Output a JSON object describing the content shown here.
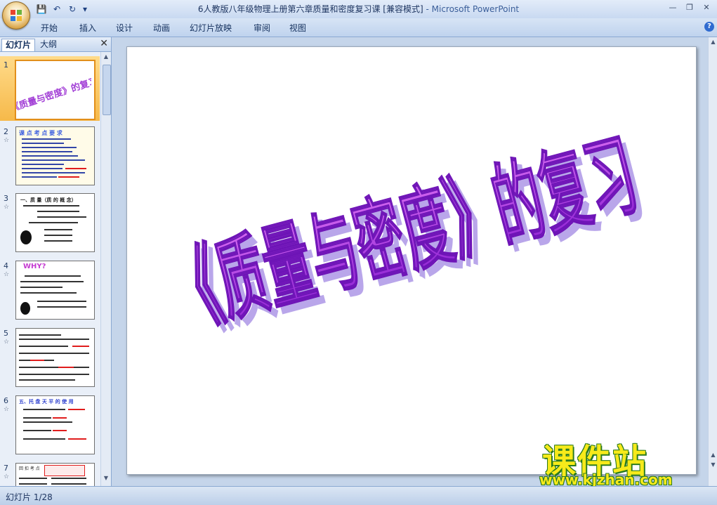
{
  "window": {
    "title": "6人教版八年级物理上册第六章质量和密度复习课 [兼容模式]",
    "app": " - Microsoft PowerPoint",
    "controls": [
      "—",
      "❐",
      "✕"
    ]
  },
  "qat": [
    "save-icon",
    "undo-icon",
    "redo-icon",
    "customize-icon"
  ],
  "ribbon": {
    "tabs": [
      "开始",
      "插入",
      "设计",
      "动画",
      "幻灯片放映",
      "审阅",
      "视图"
    ],
    "help": "?"
  },
  "pane": {
    "tab_slides": "幻灯片",
    "tab_outline": "大纲",
    "close": "✕",
    "thumbnails": [
      {
        "num": "1",
        "anim": "",
        "heading": "《质量与密度》的复习"
      },
      {
        "num": "2",
        "anim": "☆",
        "heading": "课 点 考 点 要 求"
      },
      {
        "num": "3",
        "anim": "☆",
        "heading": "一、质 量（质 的 概 念）"
      },
      {
        "num": "4",
        "anim": "☆",
        "heading": "WHY?"
      },
      {
        "num": "5",
        "anim": "☆",
        "heading": ""
      },
      {
        "num": "6",
        "anim": "☆",
        "heading": "五、托 盘 天 平 的 使 用"
      },
      {
        "num": "7",
        "anim": "☆",
        "heading": "回 扣 考 点"
      }
    ]
  },
  "slide": {
    "title": "《质量与密度》的复习"
  },
  "watermark": {
    "name": "课件站",
    "url": "www.kjzhan.com"
  },
  "status": {
    "slide_info": "幻灯片 1/28"
  }
}
